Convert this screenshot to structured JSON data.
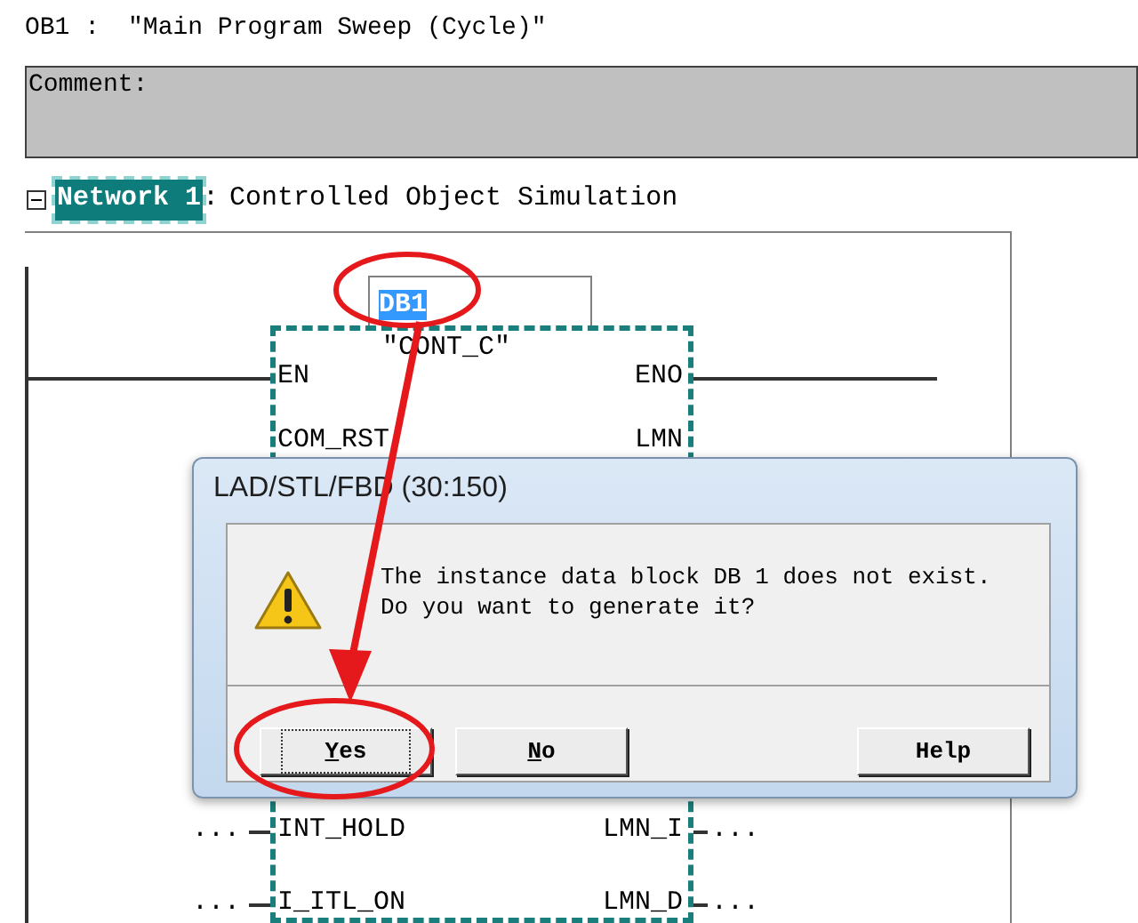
{
  "header": {
    "block": "OB1 :",
    "title": "″Main Program Sweep (Cycle)″"
  },
  "comment": {
    "label": "Comment:"
  },
  "network": {
    "expanded": true,
    "label": "Network 1",
    "selected": true,
    "separator": ":",
    "title": "Controlled Object Simulation"
  },
  "block": {
    "instance": "DB1",
    "instance_selected": true,
    "name": "″CONT_C″",
    "pins_top": [
      {
        "input": "EN",
        "output": "ENO",
        "kind": "wire"
      },
      {
        "input": "COM_RST",
        "output": "LMN",
        "kind": "open"
      }
    ],
    "pins_bottom": [
      {
        "input": "INT_HOLD",
        "output": "LMN_I",
        "kind": "param",
        "input_value": "...",
        "output_value": "..."
      },
      {
        "input": "I_ITL_ON",
        "output": "LMN_D",
        "kind": "param",
        "input_value": "...",
        "output_value": "..."
      }
    ]
  },
  "dialog": {
    "title": "LAD/STL/FBD  (30:150)",
    "message": [
      "The instance data block DB 1 does not exist.",
      "Do you want to generate it?"
    ],
    "buttons": [
      {
        "label": "Yes",
        "accelerator": true,
        "focused": true
      },
      {
        "label": "No",
        "accelerator": true,
        "focused": false
      },
      {
        "label": "Help",
        "accelerator": false,
        "focused": false
      }
    ]
  }
}
